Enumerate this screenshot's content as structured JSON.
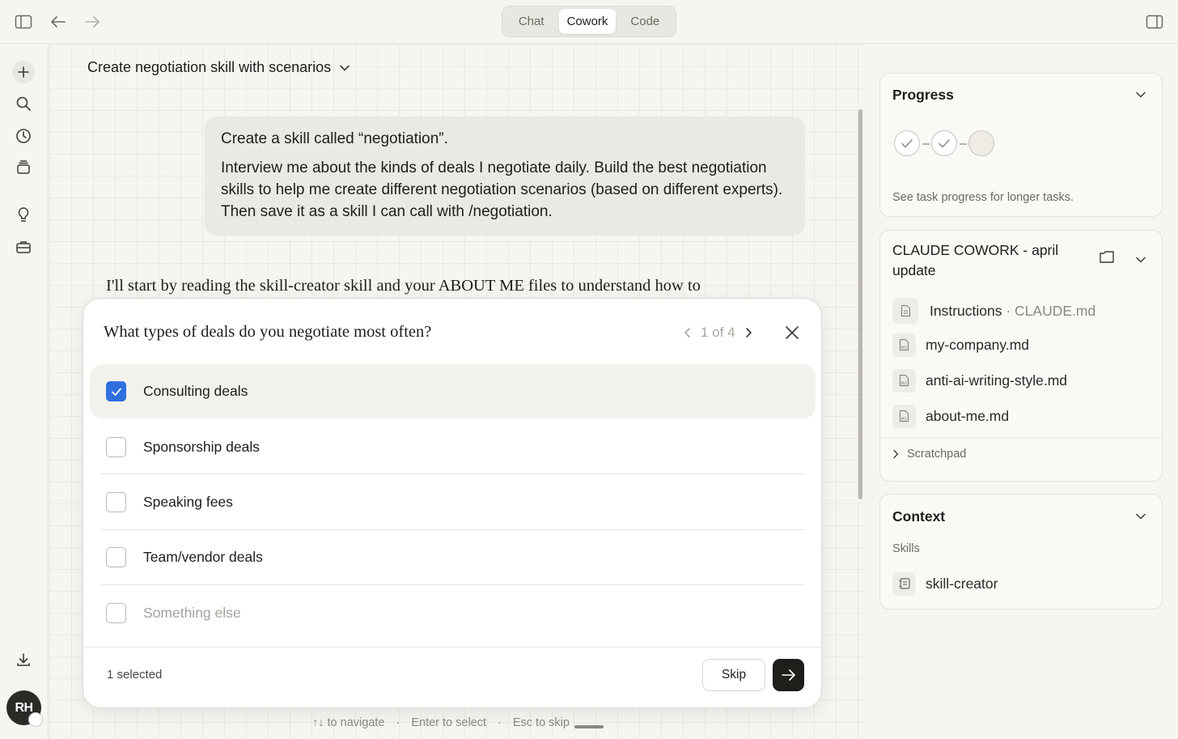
{
  "titlebar": {
    "tabs": [
      {
        "label": "Chat",
        "active": false
      },
      {
        "label": "Cowork",
        "active": true
      },
      {
        "label": "Code",
        "active": false
      }
    ]
  },
  "sidebar": {
    "icons": [
      "new-chat-icon",
      "search-icon",
      "history-icon",
      "projects-icon",
      "ideas-icon",
      "tools-icon",
      "download-icon"
    ],
    "avatar_initials": "RH"
  },
  "conversation": {
    "title": "Create negotiation skill with scenarios",
    "user_message": {
      "line1": "Create a skill called “negotiation”.",
      "line2": "Interview me about the kinds of deals I negotiate daily. Build the best negotiation skills to help me create different negotiation scenarios (based on different experts). Then save it as a skill I can call with /negotiation."
    },
    "assistant_text": "I'll start by reading the skill-creator skill and your ABOUT ME files to understand how to"
  },
  "question": {
    "title": "What types of deals do you negotiate most often?",
    "pager": "1 of 4",
    "options": [
      {
        "label": "Consulting deals",
        "checked": true
      },
      {
        "label": "Sponsorship deals",
        "checked": false
      },
      {
        "label": "Speaking fees",
        "checked": false
      },
      {
        "label": "Team/vendor deals",
        "checked": false
      },
      {
        "label": "Something else",
        "checked": false
      }
    ],
    "selected_count": "1 selected",
    "skip_label": "Skip",
    "accent_color": "#2f6fe0"
  },
  "hints": {
    "navigate": "↑↓ to navigate",
    "sep1": "·",
    "select": "Enter to select",
    "sep2": "·",
    "skip": "Esc to skip"
  },
  "right_panel": {
    "progress": {
      "title": "Progress",
      "steps": [
        "done",
        "done",
        "pending"
      ],
      "note": "See task progress for longer tasks."
    },
    "project": {
      "title": "CLAUDE COWORK - april update",
      "instructions_label": "Instructions",
      "instructions_sep": " · ",
      "instructions_file": "CLAUDE.md",
      "files": [
        "my-company.md",
        "anti-ai-writing-style.md",
        "about-me.md"
      ],
      "scratchpad": "Scratchpad"
    },
    "context": {
      "title": "Context",
      "section": "Skills",
      "skills": [
        "skill-creator"
      ]
    }
  }
}
